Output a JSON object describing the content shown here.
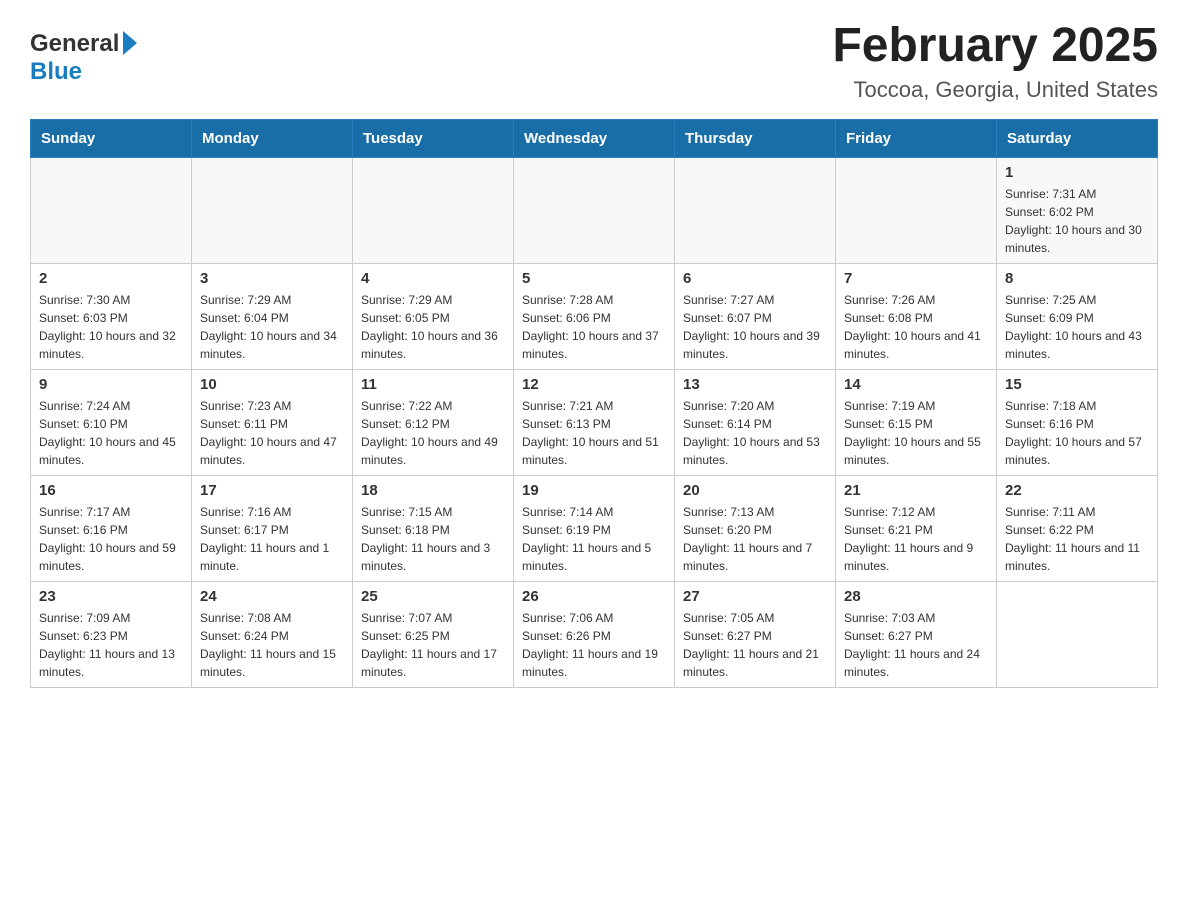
{
  "logo": {
    "general": "General",
    "blue": "Blue"
  },
  "header": {
    "month_year": "February 2025",
    "location": "Toccoa, Georgia, United States"
  },
  "weekdays": [
    "Sunday",
    "Monday",
    "Tuesday",
    "Wednesday",
    "Thursday",
    "Friday",
    "Saturday"
  ],
  "weeks": [
    [
      {
        "day": "",
        "sunrise": "",
        "sunset": "",
        "daylight": ""
      },
      {
        "day": "",
        "sunrise": "",
        "sunset": "",
        "daylight": ""
      },
      {
        "day": "",
        "sunrise": "",
        "sunset": "",
        "daylight": ""
      },
      {
        "day": "",
        "sunrise": "",
        "sunset": "",
        "daylight": ""
      },
      {
        "day": "",
        "sunrise": "",
        "sunset": "",
        "daylight": ""
      },
      {
        "day": "",
        "sunrise": "",
        "sunset": "",
        "daylight": ""
      },
      {
        "day": "1",
        "sunrise": "Sunrise: 7:31 AM",
        "sunset": "Sunset: 6:02 PM",
        "daylight": "Daylight: 10 hours and 30 minutes."
      }
    ],
    [
      {
        "day": "2",
        "sunrise": "Sunrise: 7:30 AM",
        "sunset": "Sunset: 6:03 PM",
        "daylight": "Daylight: 10 hours and 32 minutes."
      },
      {
        "day": "3",
        "sunrise": "Sunrise: 7:29 AM",
        "sunset": "Sunset: 6:04 PM",
        "daylight": "Daylight: 10 hours and 34 minutes."
      },
      {
        "day": "4",
        "sunrise": "Sunrise: 7:29 AM",
        "sunset": "Sunset: 6:05 PM",
        "daylight": "Daylight: 10 hours and 36 minutes."
      },
      {
        "day": "5",
        "sunrise": "Sunrise: 7:28 AM",
        "sunset": "Sunset: 6:06 PM",
        "daylight": "Daylight: 10 hours and 37 minutes."
      },
      {
        "day": "6",
        "sunrise": "Sunrise: 7:27 AM",
        "sunset": "Sunset: 6:07 PM",
        "daylight": "Daylight: 10 hours and 39 minutes."
      },
      {
        "day": "7",
        "sunrise": "Sunrise: 7:26 AM",
        "sunset": "Sunset: 6:08 PM",
        "daylight": "Daylight: 10 hours and 41 minutes."
      },
      {
        "day": "8",
        "sunrise": "Sunrise: 7:25 AM",
        "sunset": "Sunset: 6:09 PM",
        "daylight": "Daylight: 10 hours and 43 minutes."
      }
    ],
    [
      {
        "day": "9",
        "sunrise": "Sunrise: 7:24 AM",
        "sunset": "Sunset: 6:10 PM",
        "daylight": "Daylight: 10 hours and 45 minutes."
      },
      {
        "day": "10",
        "sunrise": "Sunrise: 7:23 AM",
        "sunset": "Sunset: 6:11 PM",
        "daylight": "Daylight: 10 hours and 47 minutes."
      },
      {
        "day": "11",
        "sunrise": "Sunrise: 7:22 AM",
        "sunset": "Sunset: 6:12 PM",
        "daylight": "Daylight: 10 hours and 49 minutes."
      },
      {
        "day": "12",
        "sunrise": "Sunrise: 7:21 AM",
        "sunset": "Sunset: 6:13 PM",
        "daylight": "Daylight: 10 hours and 51 minutes."
      },
      {
        "day": "13",
        "sunrise": "Sunrise: 7:20 AM",
        "sunset": "Sunset: 6:14 PM",
        "daylight": "Daylight: 10 hours and 53 minutes."
      },
      {
        "day": "14",
        "sunrise": "Sunrise: 7:19 AM",
        "sunset": "Sunset: 6:15 PM",
        "daylight": "Daylight: 10 hours and 55 minutes."
      },
      {
        "day": "15",
        "sunrise": "Sunrise: 7:18 AM",
        "sunset": "Sunset: 6:16 PM",
        "daylight": "Daylight: 10 hours and 57 minutes."
      }
    ],
    [
      {
        "day": "16",
        "sunrise": "Sunrise: 7:17 AM",
        "sunset": "Sunset: 6:16 PM",
        "daylight": "Daylight: 10 hours and 59 minutes."
      },
      {
        "day": "17",
        "sunrise": "Sunrise: 7:16 AM",
        "sunset": "Sunset: 6:17 PM",
        "daylight": "Daylight: 11 hours and 1 minute."
      },
      {
        "day": "18",
        "sunrise": "Sunrise: 7:15 AM",
        "sunset": "Sunset: 6:18 PM",
        "daylight": "Daylight: 11 hours and 3 minutes."
      },
      {
        "day": "19",
        "sunrise": "Sunrise: 7:14 AM",
        "sunset": "Sunset: 6:19 PM",
        "daylight": "Daylight: 11 hours and 5 minutes."
      },
      {
        "day": "20",
        "sunrise": "Sunrise: 7:13 AM",
        "sunset": "Sunset: 6:20 PM",
        "daylight": "Daylight: 11 hours and 7 minutes."
      },
      {
        "day": "21",
        "sunrise": "Sunrise: 7:12 AM",
        "sunset": "Sunset: 6:21 PM",
        "daylight": "Daylight: 11 hours and 9 minutes."
      },
      {
        "day": "22",
        "sunrise": "Sunrise: 7:11 AM",
        "sunset": "Sunset: 6:22 PM",
        "daylight": "Daylight: 11 hours and 11 minutes."
      }
    ],
    [
      {
        "day": "23",
        "sunrise": "Sunrise: 7:09 AM",
        "sunset": "Sunset: 6:23 PM",
        "daylight": "Daylight: 11 hours and 13 minutes."
      },
      {
        "day": "24",
        "sunrise": "Sunrise: 7:08 AM",
        "sunset": "Sunset: 6:24 PM",
        "daylight": "Daylight: 11 hours and 15 minutes."
      },
      {
        "day": "25",
        "sunrise": "Sunrise: 7:07 AM",
        "sunset": "Sunset: 6:25 PM",
        "daylight": "Daylight: 11 hours and 17 minutes."
      },
      {
        "day": "26",
        "sunrise": "Sunrise: 7:06 AM",
        "sunset": "Sunset: 6:26 PM",
        "daylight": "Daylight: 11 hours and 19 minutes."
      },
      {
        "day": "27",
        "sunrise": "Sunrise: 7:05 AM",
        "sunset": "Sunset: 6:27 PM",
        "daylight": "Daylight: 11 hours and 21 minutes."
      },
      {
        "day": "28",
        "sunrise": "Sunrise: 7:03 AM",
        "sunset": "Sunset: 6:27 PM",
        "daylight": "Daylight: 11 hours and 24 minutes."
      },
      {
        "day": "",
        "sunrise": "",
        "sunset": "",
        "daylight": ""
      }
    ]
  ]
}
